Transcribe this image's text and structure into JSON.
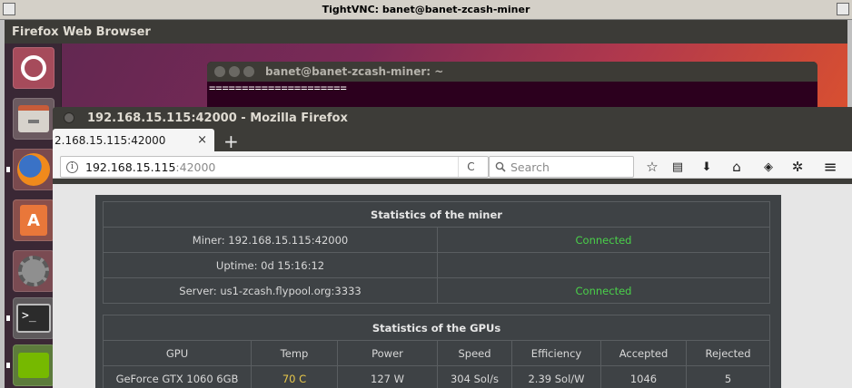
{
  "vnc": {
    "title": "TightVNC: banet@banet-zcash-miner"
  },
  "panel": {
    "app_title": "Firefox Web Browser"
  },
  "launcher": {
    "items": [
      {
        "name": "ubuntu-dash-icon"
      },
      {
        "name": "files-icon"
      },
      {
        "name": "firefox-icon"
      },
      {
        "name": "software-center-icon"
      },
      {
        "name": "system-settings-icon"
      },
      {
        "name": "terminal-icon",
        "text": ">_"
      },
      {
        "name": "nvidia-settings-icon"
      }
    ],
    "store_letter": "A"
  },
  "terminal": {
    "title": "banet@banet-zcash-miner: ~",
    "line1": "=====================",
    "line2": ""
  },
  "firefox": {
    "window_title": "192.168.15.115:42000 - Mozilla Firefox",
    "tab_label": "2.168.15.115:42000",
    "tab_close": "×",
    "new_tab": "+",
    "url_host": "192.168.15.115",
    "url_port": ":42000",
    "info_glyph": "i",
    "reload_glyph": "C",
    "search_placeholder": "Search",
    "toolbar": {
      "bookmark_star": "☆",
      "reading_list": "▤",
      "download": "⬇",
      "home": "⌂",
      "pocket": "◈",
      "extension": "✲",
      "menu": "≡"
    }
  },
  "miner_stats": {
    "title": "Statistics of the miner",
    "rows": [
      {
        "label": "Miner: 192.168.15.115:42000",
        "status": "Connected"
      },
      {
        "label": "Uptime: 0d 15:16:12",
        "status": ""
      },
      {
        "label": "Server: us1-zcash.flypool.org:3333",
        "status": "Connected"
      }
    ]
  },
  "gpu_stats": {
    "title": "Statistics of the GPUs",
    "headers": [
      "GPU",
      "Temp",
      "Power",
      "Speed",
      "Efficiency",
      "Accepted",
      "Rejected"
    ],
    "rows": [
      {
        "gpu": "GeForce GTX 1060 6GB",
        "temp": "70 C",
        "power": "127 W",
        "speed": "304 Sol/s",
        "efficiency": "2.39 Sol/W",
        "accepted": "1046",
        "rejected": "5"
      }
    ]
  },
  "colors": {
    "connected": "#4ad04a",
    "temp": "#e8c84a",
    "panel_bg": "#3e4245"
  }
}
